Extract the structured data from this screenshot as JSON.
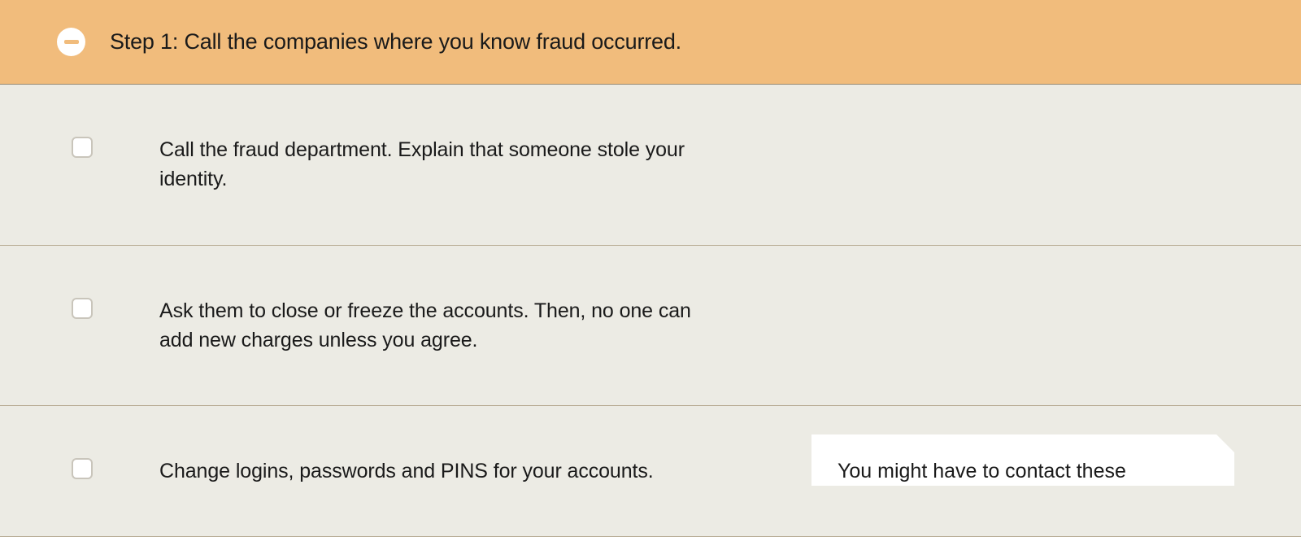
{
  "step": {
    "title": "Step 1: Call the companies where you know fraud occurred."
  },
  "items": [
    {
      "text": "Call the fraud department. Explain that someone stole your identity."
    },
    {
      "text": "Ask them to close or freeze the accounts. Then, no one can add new charges unless you agree."
    },
    {
      "text": "Change logins, passwords and PINS for your accounts."
    }
  ],
  "tooltip": {
    "text": "You might have to contact these"
  }
}
